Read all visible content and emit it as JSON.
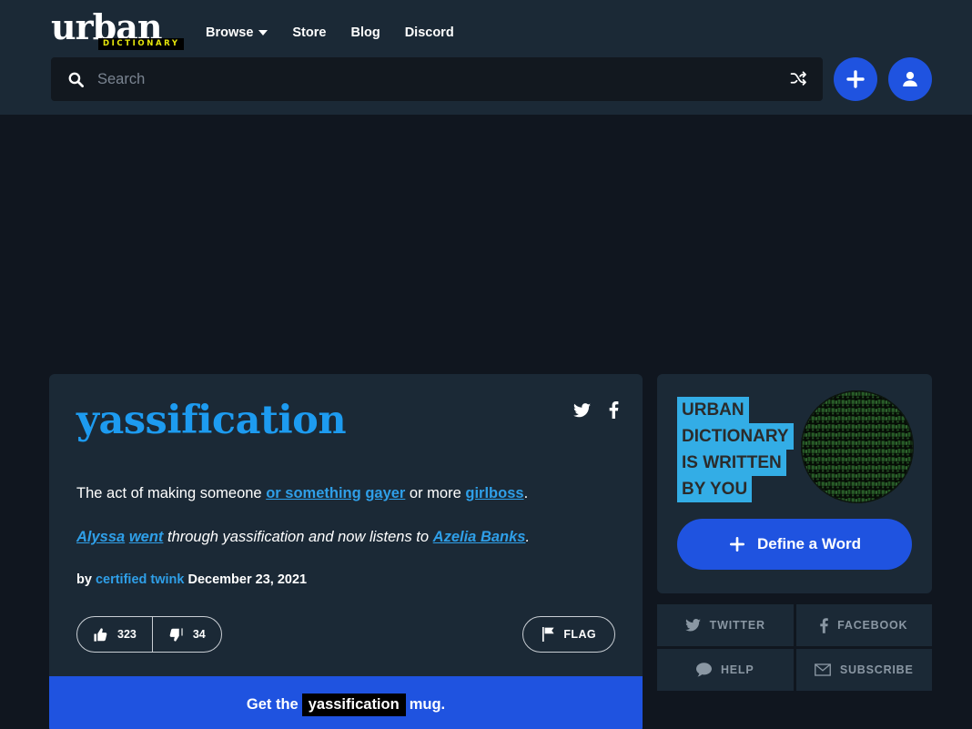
{
  "header": {
    "logo": {
      "word": "urban",
      "sub": "DICTIONARY"
    },
    "nav": [
      {
        "label": "Browse",
        "icon": "chevron-down-icon",
        "has_caret": true
      },
      {
        "label": "Store",
        "has_caret": false
      },
      {
        "label": "Blog",
        "has_caret": false
      },
      {
        "label": "Discord",
        "has_caret": false
      }
    ],
    "search": {
      "placeholder": "Search",
      "value": "",
      "search_icon": "search-icon",
      "shuffle_icon": "shuffle-icon"
    },
    "add_button": {
      "icon": "plus-icon"
    },
    "account_button": {
      "icon": "user-icon"
    }
  },
  "definition": {
    "word": "yassification",
    "share": {
      "twitter": "twitter-icon",
      "facebook": "facebook-icon"
    },
    "meaning": {
      "parts": [
        {
          "text": "The act of making someone ",
          "link": false
        },
        {
          "text": "or something",
          "link": true
        },
        {
          "text": " ",
          "link": false
        },
        {
          "text": "gayer",
          "link": true
        },
        {
          "text": " or more ",
          "link": false
        },
        {
          "text": "girlboss",
          "link": true
        },
        {
          "text": ".",
          "link": false
        }
      ]
    },
    "example": {
      "parts": [
        {
          "text": "Alyssa",
          "link": true
        },
        {
          "text": " ",
          "link": false
        },
        {
          "text": "went",
          "link": true
        },
        {
          "text": " through yassification and now listens to ",
          "link": false
        },
        {
          "text": "Azelia Banks",
          "link": true
        },
        {
          "text": ".",
          "link": false
        }
      ]
    },
    "byline_prefix": "by",
    "author": "certified twink",
    "date": "December 23, 2021",
    "upvotes": "323",
    "downvotes": "34",
    "flag_label": "FLAG",
    "mug_banner": {
      "prefix": "Get the",
      "word": "yassification",
      "suffix": "mug."
    }
  },
  "sidebar": {
    "promo_lines": [
      "URBAN",
      "DICTIONARY",
      "IS WRITTEN",
      "BY YOU"
    ],
    "define_button": "Define a Word",
    "tiles": [
      {
        "label": "TWITTER",
        "icon": "twitter-icon"
      },
      {
        "label": "FACEBOOK",
        "icon": "facebook-icon"
      },
      {
        "label": "HELP",
        "icon": "chat-bubble-icon"
      },
      {
        "label": "SUBSCRIBE",
        "icon": "envelope-icon"
      }
    ]
  },
  "colors": {
    "header_bg": "#1b2936",
    "page_bg": "#10161f",
    "card_bg": "#1b2936",
    "accent_blue": "#1f53e0",
    "link_blue": "#2f9fe8",
    "promo_highlight": "#33ade6",
    "logo_yellow": "#e8e80c"
  }
}
